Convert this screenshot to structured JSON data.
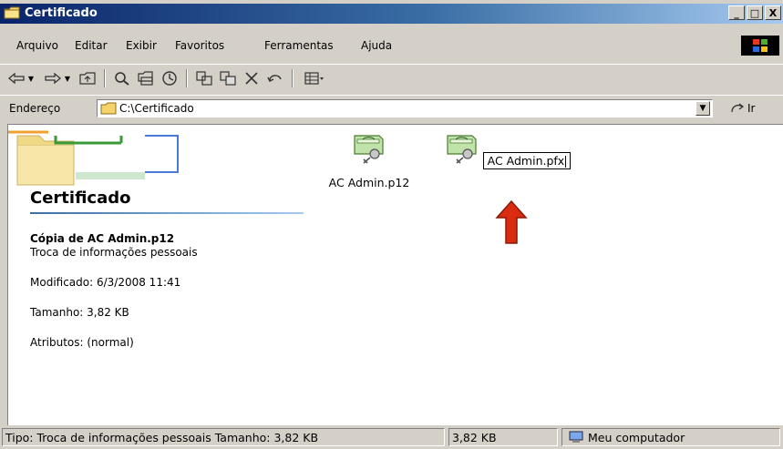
{
  "window": {
    "title": "Certificado",
    "controls": [
      "_",
      "□",
      "X"
    ]
  },
  "menu": {
    "items": [
      "Arquivo",
      "Editar",
      "Exibir",
      "Favoritos",
      "Ferramentas",
      "Ajuda"
    ]
  },
  "address": {
    "label": "Endereço",
    "path": "C:\\Certificado",
    "go_label": "Ir"
  },
  "panel": {
    "title": "Certificado",
    "selected_name": "Cópia de AC Admin.p12",
    "selected_type": "Troca de informações pessoais",
    "modified": "Modificado: 6/3/2008 11:41",
    "size": "Tamanho: 3,82 KB",
    "attributes": "Atributos: (normal)"
  },
  "files": [
    {
      "name": "AC Admin.p12"
    },
    {
      "name": "AC Admin.pfx"
    }
  ],
  "status": {
    "info": "Tipo: Troca de informações pessoais Tamanho: 3,82 KB",
    "size": "3,82 KB",
    "zone": "Meu computador"
  },
  "colors": {
    "titlebar_start": "#0a246a",
    "titlebar_end": "#a6caf0",
    "arrow": "#d92c10"
  },
  "icons": [
    "folder-icon",
    "back-icon",
    "forward-icon",
    "up-folder-icon",
    "search-icon",
    "folders-icon",
    "history-icon",
    "move-to-icon",
    "copy-to-icon",
    "delete-icon",
    "undo-icon",
    "views-icon",
    "go-icon",
    "certificate-icon",
    "computer-icon",
    "windows-logo-icon"
  ]
}
